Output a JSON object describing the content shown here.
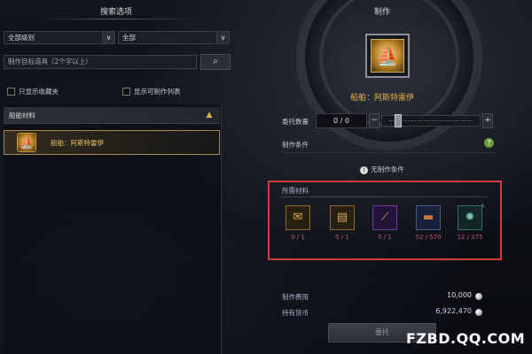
{
  "left_panel": {
    "title": "搜索选项",
    "grade_select": "全部级别",
    "category_select": "全部",
    "search_placeholder": "制作目标道具（2个字以上）",
    "checkbox_favorites": "只显示收藏夹",
    "checkbox_craftable": "显示可制作列表",
    "category_header": "船舶材料",
    "selected_item": "船舶：阿斯特雷伊"
  },
  "right_panel": {
    "title": "制作",
    "product_name": "船舶：阿斯特雷伊",
    "quantity_label": "委托数量",
    "quantity_value": "0 / 0",
    "condition_label": "制作条件",
    "no_condition": "无制作条件",
    "materials_title": "所需材料",
    "materials": [
      {
        "icon": "scroll-icon",
        "count": "0 / 1",
        "color": "#c08a2c"
      },
      {
        "icon": "parchment-icon",
        "count": "0 / 1",
        "color": "#b08a40"
      },
      {
        "icon": "blueprint-icon",
        "count": "0 / 1",
        "color": "#6a3a9a"
      },
      {
        "icon": "timber-icon",
        "count": "52 / 570",
        "color": "#a55a2a"
      },
      {
        "icon": "gear-material-icon",
        "count": "12 / 375",
        "color": "#4a7a7a"
      }
    ],
    "craft_cost_label": "制作费用",
    "craft_cost_value": "10,000",
    "owned_currency_label": "持有货币",
    "owned_currency_value": "6,922,470",
    "commission_button": "委托"
  },
  "watermark": "FZBD.QQ.COM",
  "colors": {
    "accent_gold": "#e5b548",
    "highlight_red": "#d63a3a",
    "insufficient": "#c0516a"
  }
}
